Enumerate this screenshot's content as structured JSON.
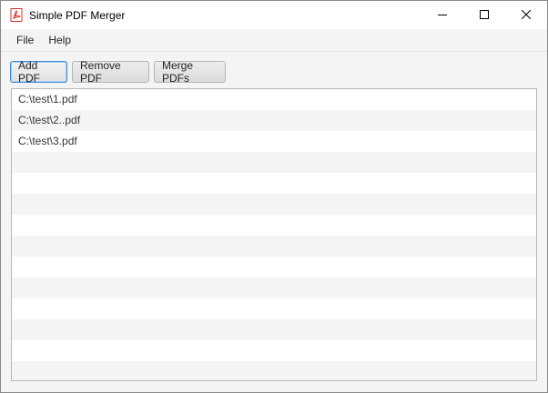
{
  "window": {
    "title": "Simple PDF Merger",
    "app_icon": "pdf-icon",
    "controls": [
      "minimize-icon",
      "maximize-icon",
      "close-icon"
    ]
  },
  "menu": {
    "items": [
      {
        "label": "File"
      },
      {
        "label": "Help"
      }
    ]
  },
  "toolbar": {
    "add_label": "Add PDF",
    "remove_label": "Remove PDF",
    "merge_label": "Merge PDFs"
  },
  "file_list": {
    "items": [
      "C:\\test\\1.pdf",
      "C:\\test\\2..pdf",
      "C:\\test\\3.pdf"
    ],
    "visible_rows": 14
  },
  "colors": {
    "accent": "#3a8ad6",
    "pdf_icon": "#d9322b",
    "stripe": "#f4f4f4"
  }
}
